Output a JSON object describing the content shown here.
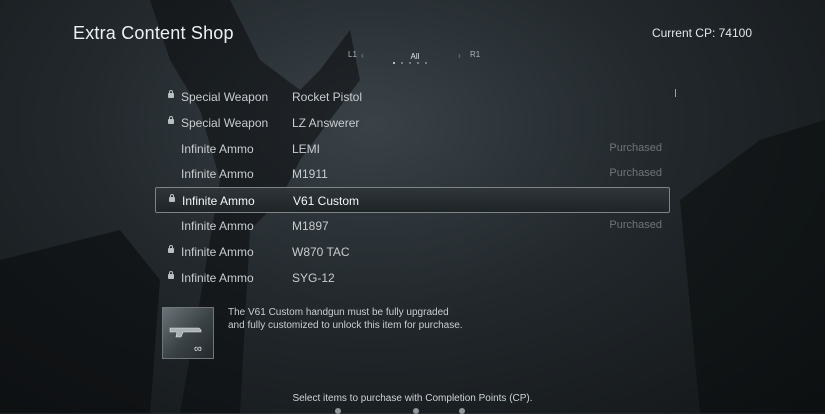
{
  "header": {
    "title": "Extra Content Shop",
    "current_cp": "Current CP: 74100"
  },
  "tabs": {
    "left_button": "L1",
    "right_button": "R1",
    "left_arrow": "‹",
    "right_arrow": "›",
    "active_tab": "All",
    "page_count": 5,
    "active_page": 1
  },
  "items": [
    {
      "category": "Special Weapon",
      "name": "Rocket Pistol",
      "locked": true,
      "status": ""
    },
    {
      "category": "Special Weapon",
      "name": "LZ Answerer",
      "locked": true,
      "status": ""
    },
    {
      "category": "Infinite Ammo",
      "name": "LEMI",
      "locked": false,
      "status": "Purchased"
    },
    {
      "category": "Infinite Ammo",
      "name": "M1911",
      "locked": false,
      "status": "Purchased"
    },
    {
      "category": "Infinite Ammo",
      "name": "V61 Custom",
      "locked": true,
      "status": "",
      "selected": true
    },
    {
      "category": "Infinite Ammo",
      "name": "M1897",
      "locked": false,
      "status": "Purchased"
    },
    {
      "category": "Infinite Ammo",
      "name": "W870 TAC",
      "locked": true,
      "status": ""
    },
    {
      "category": "Infinite Ammo",
      "name": "SYG-12",
      "locked": true,
      "status": ""
    }
  ],
  "description": {
    "text": "The V61 Custom handgun must be fully upgraded\nand fully customized to unlock this item for purchase.",
    "thumbnail_icon": "handgun-infinite-icon",
    "infinity_symbol": "∞"
  },
  "footer": {
    "instruction": "Select items to purchase with Completion Points (CP)."
  },
  "colors": {
    "selected_border": "#7d8488",
    "purchased_text": "#6e7478",
    "text": "#c7ccd0"
  }
}
